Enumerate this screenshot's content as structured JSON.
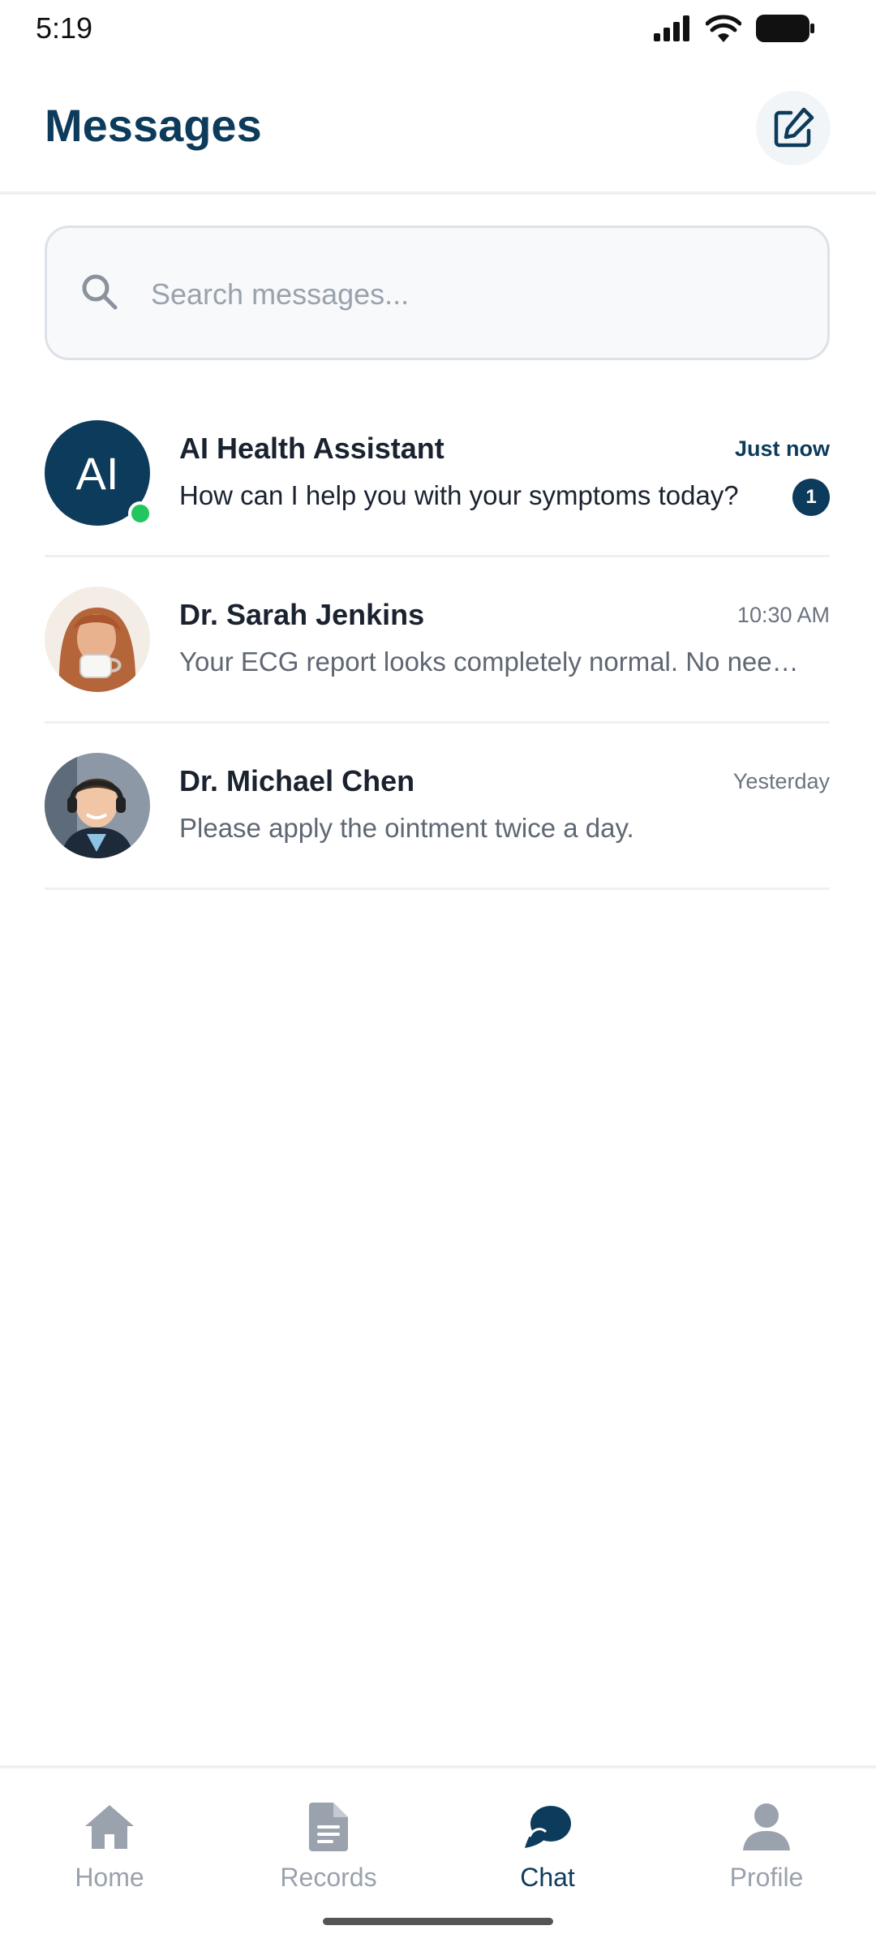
{
  "status_bar": {
    "time": "5:19",
    "icons": [
      "signal-icon",
      "wifi-icon",
      "battery-icon"
    ]
  },
  "header": {
    "title": "Messages",
    "compose_icon": "compose-icon"
  },
  "search": {
    "placeholder": "Search messages...",
    "value": ""
  },
  "conversations": [
    {
      "name": "AI Health Assistant",
      "avatar_text": "AI",
      "online": true,
      "time": "Just now",
      "message": "How can I help you with your symptoms today?",
      "unread_count": "1"
    },
    {
      "name": "Dr. Sarah Jenkins",
      "avatar_icon": "user-photo-icon",
      "time": "10:30 AM",
      "message": "Your ECG report looks completely normal. No need to worry about the results."
    },
    {
      "name": "Dr. Michael Chen",
      "avatar_icon": "user-photo-icon",
      "time": "Yesterday",
      "message": "Please apply the ointment twice a day."
    }
  ],
  "bottom_nav": {
    "items": [
      {
        "label": "Home",
        "icon": "home-icon",
        "active": false
      },
      {
        "label": "Records",
        "icon": "document-icon",
        "active": false
      },
      {
        "label": "Chat",
        "icon": "chat-icon",
        "active": true
      },
      {
        "label": "Profile",
        "icon": "person-icon",
        "active": false
      }
    ]
  },
  "colors": {
    "primary": "#0d3b5c",
    "online": "#22c55e",
    "muted": "#9aa2ad"
  }
}
